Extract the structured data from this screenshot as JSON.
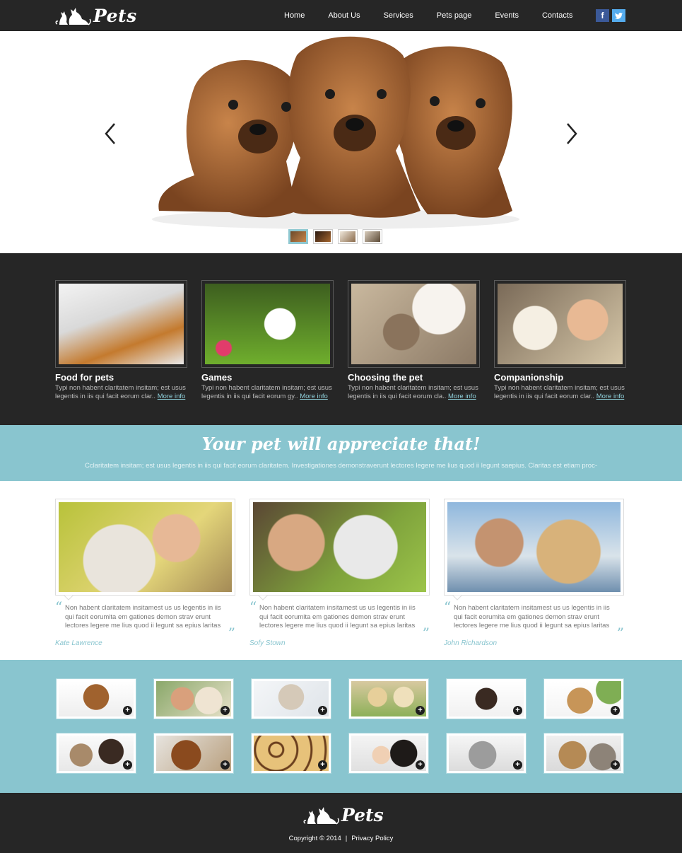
{
  "header": {
    "logo_text": "Pets",
    "nav": [
      "Home",
      "About Us",
      "Services",
      "Pets page",
      "Events",
      "Contacts"
    ],
    "social": {
      "facebook": "f",
      "twitter": "t"
    }
  },
  "slider": {
    "thumbnail_count": 4,
    "active_thumbnail": 1
  },
  "features": [
    {
      "title": "Food for pets",
      "text": "Typi non habent claritatem insitam; est usus legentis in iis qui facit eorum clar..",
      "link": "More info"
    },
    {
      "title": "Games",
      "text": "Typi non habent claritatem insitam; est usus legentis in iis qui facit eorum gy..",
      "link": "More info"
    },
    {
      "title": "Choosing the pet",
      "text": "Typi non habent claritatem insitam; est usus legentis in iis qui facit eorum cla..",
      "link": "More info"
    },
    {
      "title": "Companionship",
      "text": "Typi non habent claritatem insitam; est usus legentis in iis qui facit eorum clar..",
      "link": "More info"
    }
  ],
  "banner": {
    "title": "Your pet will appreciate that!",
    "text": "Cclaritatem insitam; est usus legentis in iis qui facit eorum claritatem. Investigationes demonstraverunt lectores legere me lius quod ii legunt saepius. Claritas est etiam proc-"
  },
  "testimonials": [
    {
      "text": "Non habent claritatem insitamest us us legentis in iis qui facit eorumita em gationes demon strav erunt lectores legere me lius quod ii legunt sa epius laritas",
      "author": "Kate Lawrence"
    },
    {
      "text": "Non habent claritatem insitamest us us legentis in iis qui facit eorumita em gationes demon strav erunt lectores legere me lius quod ii legunt sa epius laritas",
      "author": "Sofy Stown"
    },
    {
      "text": "Non habent claritatem insitamest us us legentis in iis qui facit eorumita em gationes demon strav erunt lectores legere me lius quod ii legunt sa epius laritas",
      "author": "John Richardson"
    }
  ],
  "gallery": {
    "plus_icon": "+",
    "items": 12
  },
  "footer": {
    "logo_text": "Pets",
    "copyright": "Copyright © 2014",
    "separator": "|",
    "privacy": "Privacy Policy"
  },
  "colors": {
    "dark": "#262626",
    "accent": "#89c5cf"
  }
}
